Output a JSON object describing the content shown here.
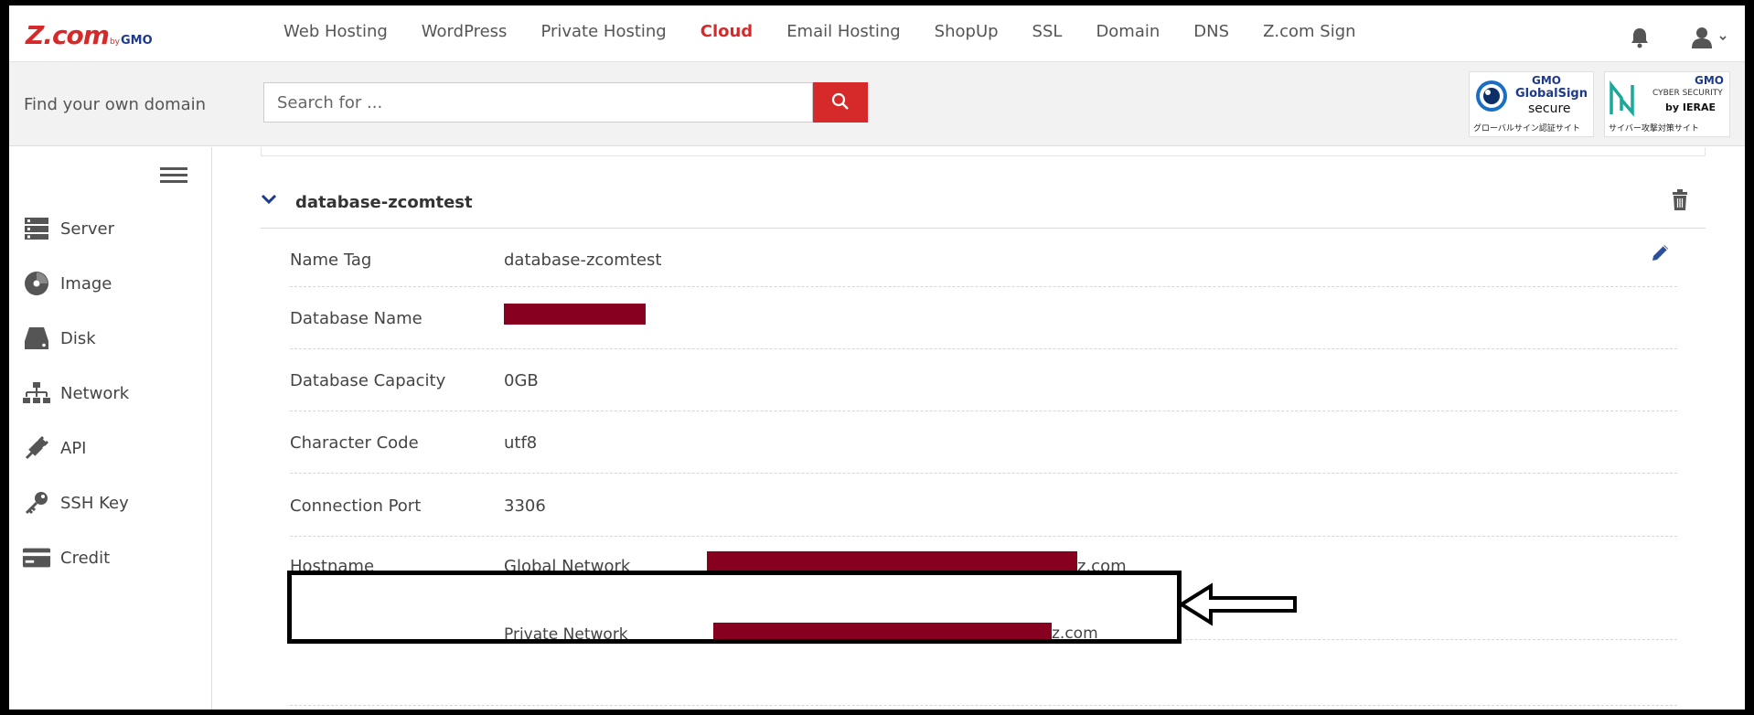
{
  "logo": {
    "main": "Z.com",
    "by": "by",
    "brand": "GMO"
  },
  "nav": {
    "items": [
      "Web Hosting",
      "WordPress",
      "Private Hosting",
      "Cloud",
      "Email Hosting",
      "ShopUp",
      "SSL",
      "Domain",
      "DNS",
      "Z.com Sign"
    ],
    "active": "Cloud",
    "icons": [
      "bell-icon",
      "user-icon"
    ]
  },
  "search": {
    "label": "Find your own domain",
    "placeholder": "Search for ...",
    "button_icon": "search-icon"
  },
  "badges": [
    {
      "brand": "GMO",
      "line1": "GlobalSign",
      "line2": "secure",
      "caption": "グローバルサイン認証サイト"
    },
    {
      "brand": "GMO",
      "line1": "CYBER SECURITY",
      "line2": "by IERAE",
      "caption": "サイバー攻撃対策サイト"
    }
  ],
  "sidebar": {
    "items": [
      {
        "label": "Server",
        "icon": "server-icon"
      },
      {
        "label": "Image",
        "icon": "disc-icon"
      },
      {
        "label": "Disk",
        "icon": "disk-icon"
      },
      {
        "label": "Network",
        "icon": "network-icon"
      },
      {
        "label": "API",
        "icon": "api-plug-icon"
      },
      {
        "label": "SSH Key",
        "icon": "key-icon"
      },
      {
        "label": "Credit",
        "icon": "credit-card-icon"
      }
    ]
  },
  "database": {
    "title": "database-zcomtest",
    "rows": [
      {
        "label": "Name Tag",
        "value": "database-zcomtest"
      },
      {
        "label": "Database Name",
        "value": ""
      },
      {
        "label": "Database Capacity",
        "value": "0GB"
      },
      {
        "label": "Character Code",
        "value": "utf8"
      },
      {
        "label": "Connection Port",
        "value": "3306"
      },
      {
        "label": "Hostname",
        "value": "Global Network",
        "suffix": "z.com"
      },
      {
        "label": "",
        "value": "Private Network",
        "suffix": "z.com"
      }
    ]
  },
  "colors": {
    "brand_red": "#d62a2a",
    "redaction": "#880020",
    "navy": "#1e3a8a"
  }
}
